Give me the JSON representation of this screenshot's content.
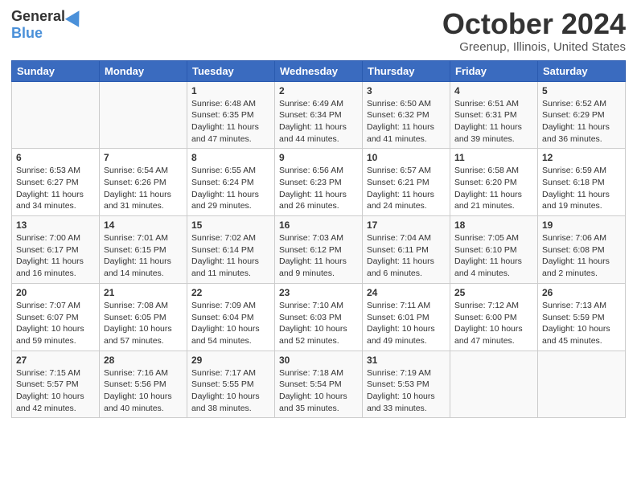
{
  "header": {
    "logo_general": "General",
    "logo_blue": "Blue",
    "month": "October 2024",
    "location": "Greenup, Illinois, United States"
  },
  "days_of_week": [
    "Sunday",
    "Monday",
    "Tuesday",
    "Wednesday",
    "Thursday",
    "Friday",
    "Saturday"
  ],
  "weeks": [
    [
      {
        "day": "",
        "info": ""
      },
      {
        "day": "",
        "info": ""
      },
      {
        "day": "1",
        "info": "Sunrise: 6:48 AM\nSunset: 6:35 PM\nDaylight: 11 hours and 47 minutes."
      },
      {
        "day": "2",
        "info": "Sunrise: 6:49 AM\nSunset: 6:34 PM\nDaylight: 11 hours and 44 minutes."
      },
      {
        "day": "3",
        "info": "Sunrise: 6:50 AM\nSunset: 6:32 PM\nDaylight: 11 hours and 41 minutes."
      },
      {
        "day": "4",
        "info": "Sunrise: 6:51 AM\nSunset: 6:31 PM\nDaylight: 11 hours and 39 minutes."
      },
      {
        "day": "5",
        "info": "Sunrise: 6:52 AM\nSunset: 6:29 PM\nDaylight: 11 hours and 36 minutes."
      }
    ],
    [
      {
        "day": "6",
        "info": "Sunrise: 6:53 AM\nSunset: 6:27 PM\nDaylight: 11 hours and 34 minutes."
      },
      {
        "day": "7",
        "info": "Sunrise: 6:54 AM\nSunset: 6:26 PM\nDaylight: 11 hours and 31 minutes."
      },
      {
        "day": "8",
        "info": "Sunrise: 6:55 AM\nSunset: 6:24 PM\nDaylight: 11 hours and 29 minutes."
      },
      {
        "day": "9",
        "info": "Sunrise: 6:56 AM\nSunset: 6:23 PM\nDaylight: 11 hours and 26 minutes."
      },
      {
        "day": "10",
        "info": "Sunrise: 6:57 AM\nSunset: 6:21 PM\nDaylight: 11 hours and 24 minutes."
      },
      {
        "day": "11",
        "info": "Sunrise: 6:58 AM\nSunset: 6:20 PM\nDaylight: 11 hours and 21 minutes."
      },
      {
        "day": "12",
        "info": "Sunrise: 6:59 AM\nSunset: 6:18 PM\nDaylight: 11 hours and 19 minutes."
      }
    ],
    [
      {
        "day": "13",
        "info": "Sunrise: 7:00 AM\nSunset: 6:17 PM\nDaylight: 11 hours and 16 minutes."
      },
      {
        "day": "14",
        "info": "Sunrise: 7:01 AM\nSunset: 6:15 PM\nDaylight: 11 hours and 14 minutes."
      },
      {
        "day": "15",
        "info": "Sunrise: 7:02 AM\nSunset: 6:14 PM\nDaylight: 11 hours and 11 minutes."
      },
      {
        "day": "16",
        "info": "Sunrise: 7:03 AM\nSunset: 6:12 PM\nDaylight: 11 hours and 9 minutes."
      },
      {
        "day": "17",
        "info": "Sunrise: 7:04 AM\nSunset: 6:11 PM\nDaylight: 11 hours and 6 minutes."
      },
      {
        "day": "18",
        "info": "Sunrise: 7:05 AM\nSunset: 6:10 PM\nDaylight: 11 hours and 4 minutes."
      },
      {
        "day": "19",
        "info": "Sunrise: 7:06 AM\nSunset: 6:08 PM\nDaylight: 11 hours and 2 minutes."
      }
    ],
    [
      {
        "day": "20",
        "info": "Sunrise: 7:07 AM\nSunset: 6:07 PM\nDaylight: 10 hours and 59 minutes."
      },
      {
        "day": "21",
        "info": "Sunrise: 7:08 AM\nSunset: 6:05 PM\nDaylight: 10 hours and 57 minutes."
      },
      {
        "day": "22",
        "info": "Sunrise: 7:09 AM\nSunset: 6:04 PM\nDaylight: 10 hours and 54 minutes."
      },
      {
        "day": "23",
        "info": "Sunrise: 7:10 AM\nSunset: 6:03 PM\nDaylight: 10 hours and 52 minutes."
      },
      {
        "day": "24",
        "info": "Sunrise: 7:11 AM\nSunset: 6:01 PM\nDaylight: 10 hours and 49 minutes."
      },
      {
        "day": "25",
        "info": "Sunrise: 7:12 AM\nSunset: 6:00 PM\nDaylight: 10 hours and 47 minutes."
      },
      {
        "day": "26",
        "info": "Sunrise: 7:13 AM\nSunset: 5:59 PM\nDaylight: 10 hours and 45 minutes."
      }
    ],
    [
      {
        "day": "27",
        "info": "Sunrise: 7:15 AM\nSunset: 5:57 PM\nDaylight: 10 hours and 42 minutes."
      },
      {
        "day": "28",
        "info": "Sunrise: 7:16 AM\nSunset: 5:56 PM\nDaylight: 10 hours and 40 minutes."
      },
      {
        "day": "29",
        "info": "Sunrise: 7:17 AM\nSunset: 5:55 PM\nDaylight: 10 hours and 38 minutes."
      },
      {
        "day": "30",
        "info": "Sunrise: 7:18 AM\nSunset: 5:54 PM\nDaylight: 10 hours and 35 minutes."
      },
      {
        "day": "31",
        "info": "Sunrise: 7:19 AM\nSunset: 5:53 PM\nDaylight: 10 hours and 33 minutes."
      },
      {
        "day": "",
        "info": ""
      },
      {
        "day": "",
        "info": ""
      }
    ]
  ]
}
